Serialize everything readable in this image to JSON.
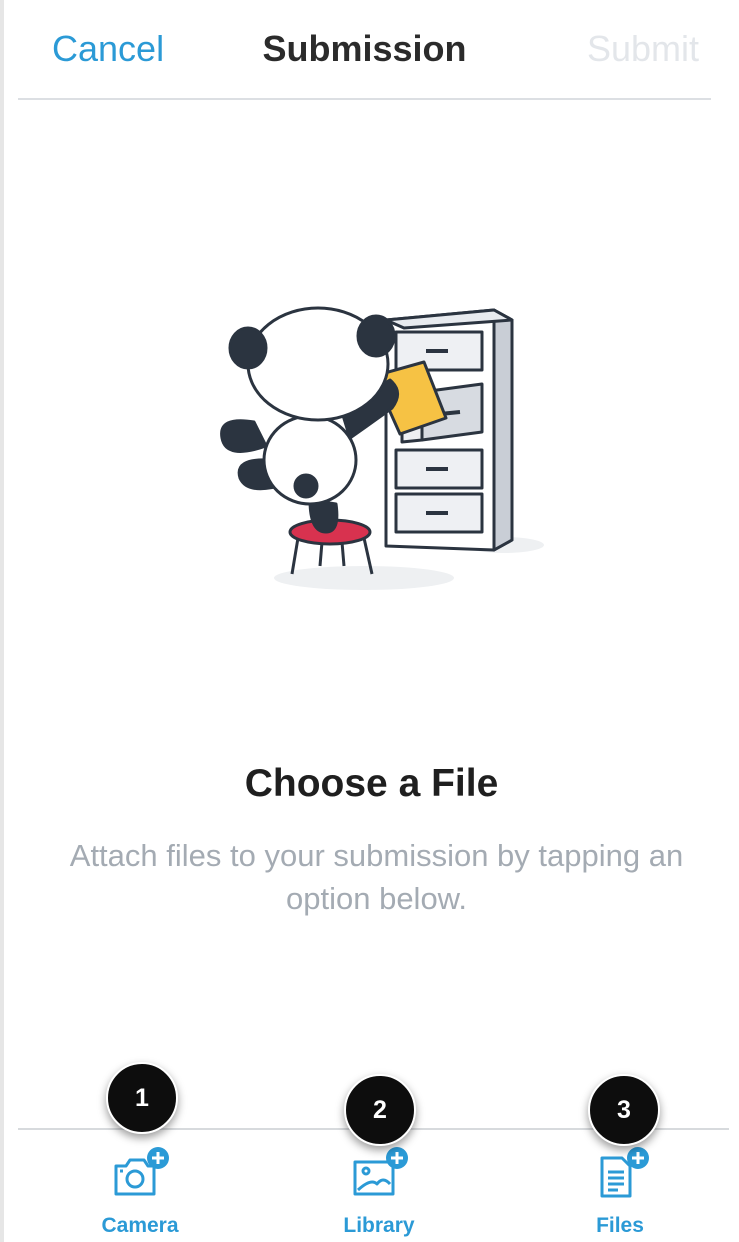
{
  "nav": {
    "cancel_label": "Cancel",
    "title": "Submission",
    "submit_label": "Submit"
  },
  "empty_state": {
    "title": "Choose a File",
    "description": "Attach files to your submission by tapping an option below."
  },
  "toolbar": {
    "items": [
      {
        "label": "Camera",
        "icon": "camera-add-icon",
        "badge": "1"
      },
      {
        "label": "Library",
        "icon": "photo-library-add-icon",
        "badge": "2"
      },
      {
        "label": "Files",
        "icon": "file-add-icon",
        "badge": "3"
      }
    ]
  },
  "colors": {
    "accent": "#2b9ad6",
    "disabled": "#e3e6ea",
    "muted_text": "#a4abb3",
    "badge": "#0d0d0d",
    "stool": "#d8324f",
    "folder": "#f6c244"
  }
}
